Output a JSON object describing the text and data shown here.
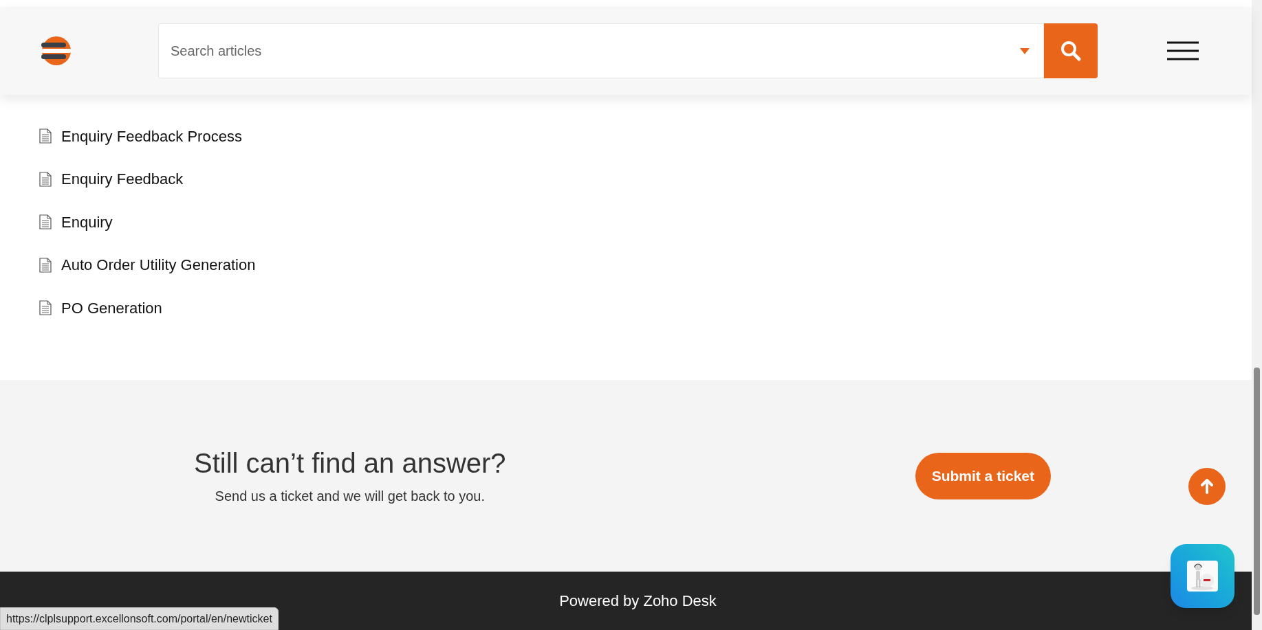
{
  "header": {
    "search": {
      "placeholder": "Search articles"
    }
  },
  "articles": [
    {
      "title": "Enquiry Feedback Process"
    },
    {
      "title": "Enquiry Feedback"
    },
    {
      "title": "Enquiry"
    },
    {
      "title": "Auto Order Utility Generation"
    },
    {
      "title": "PO Generation"
    }
  ],
  "cta": {
    "heading": "Still can’t find an answer?",
    "text": "Send us a ticket and we will get back to you.",
    "button": "Submit a ticket"
  },
  "footer": {
    "text": "Powered by Zoho Desk"
  },
  "status_bar": {
    "url": "https://clplsupport.excellonsoft.com/portal/en/newticket"
  }
}
